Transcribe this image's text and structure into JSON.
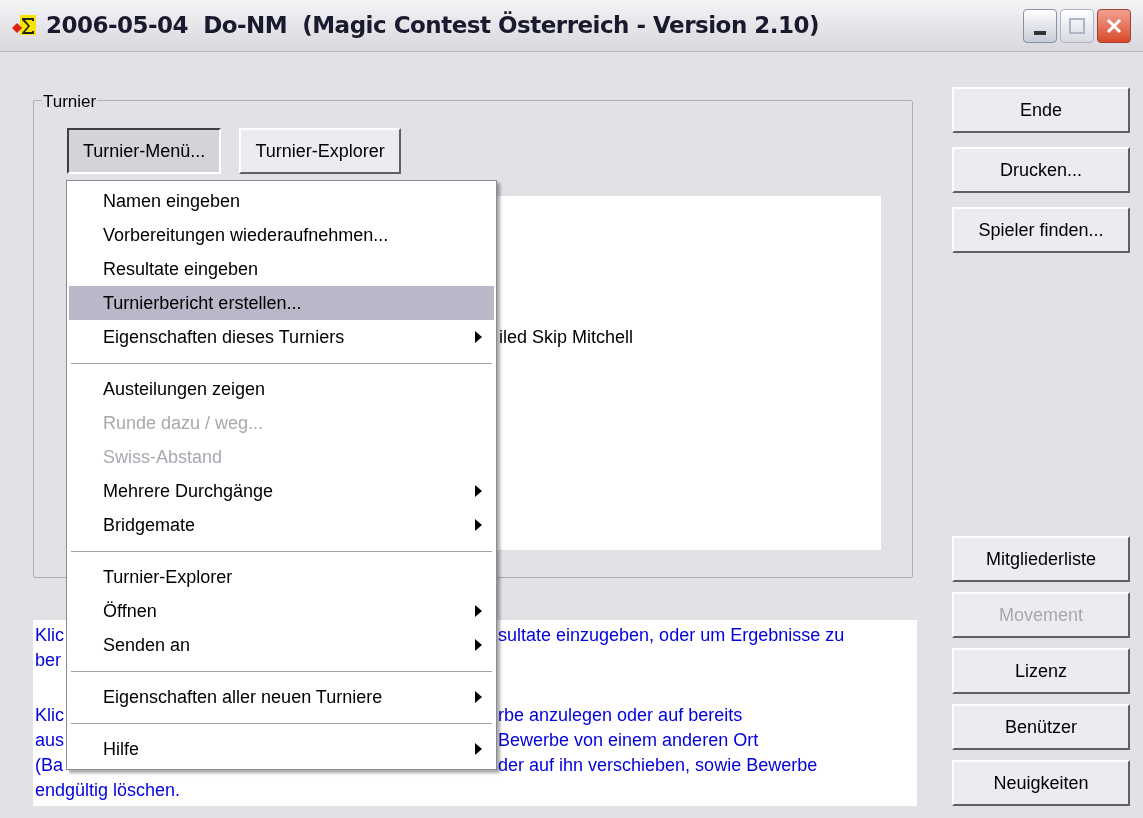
{
  "window": {
    "title": "2006-05-04  Do-NM  (Magic Contest Österreich - Version 2.10)"
  },
  "group": {
    "label": "Turnier",
    "buttons": [
      {
        "label": "Turnier-Menü...",
        "pressed": true
      },
      {
        "label": "Turnier-Explorer",
        "pressed": false
      }
    ],
    "panel_text": "iled Skip Mitchell"
  },
  "menu": [
    {
      "kind": "item",
      "label": "Namen eingeben",
      "submenu": false,
      "disabled": false,
      "selected": false
    },
    {
      "kind": "item",
      "label": "Vorbereitungen wiederaufnehmen...",
      "submenu": false,
      "disabled": false,
      "selected": false
    },
    {
      "kind": "item",
      "label": "Resultate eingeben",
      "submenu": false,
      "disabled": false,
      "selected": false
    },
    {
      "kind": "item",
      "label": "Turnierbericht erstellen...",
      "submenu": false,
      "disabled": false,
      "selected": true
    },
    {
      "kind": "item",
      "label": "Eigenschaften dieses Turniers",
      "submenu": true,
      "disabled": false,
      "selected": false
    },
    {
      "kind": "separator"
    },
    {
      "kind": "item",
      "label": "Austeilungen zeigen",
      "submenu": false,
      "disabled": false,
      "selected": false
    },
    {
      "kind": "item",
      "label": "Runde dazu / weg...",
      "submenu": false,
      "disabled": true,
      "selected": false
    },
    {
      "kind": "item",
      "label": "Swiss-Abstand",
      "submenu": false,
      "disabled": true,
      "selected": false
    },
    {
      "kind": "item",
      "label": "Mehrere Durchgänge",
      "submenu": true,
      "disabled": false,
      "selected": false
    },
    {
      "kind": "item",
      "label": "Bridgemate",
      "submenu": true,
      "disabled": false,
      "selected": false
    },
    {
      "kind": "separator"
    },
    {
      "kind": "item",
      "label": "Turnier-Explorer",
      "submenu": false,
      "disabled": false,
      "selected": false
    },
    {
      "kind": "item",
      "label": "Öffnen",
      "submenu": true,
      "disabled": false,
      "selected": false
    },
    {
      "kind": "item",
      "label": "Senden an",
      "submenu": true,
      "disabled": false,
      "selected": false
    },
    {
      "kind": "separator"
    },
    {
      "kind": "item",
      "label": "Eigenschaften aller neuen Turniere",
      "submenu": true,
      "disabled": false,
      "selected": false
    },
    {
      "kind": "separator"
    },
    {
      "kind": "item",
      "label": "Hilfe",
      "submenu": true,
      "disabled": false,
      "selected": false
    }
  ],
  "info_paragraphs": [
    [
      {
        "left": "Klic",
        "right": "sultate einzugeben, oder um Ergebnisse zu"
      },
      {
        "left": "ber"
      }
    ],
    [
      {
        "left": "Klic",
        "right": "rbe anzulegen oder auf bereits"
      },
      {
        "left": "aus",
        "right": "Bewerbe von einem anderen Ort"
      },
      {
        "left": "(Ba",
        "right": "der auf ihn verschieben, sowie Bewerbe"
      },
      {
        "left": "endgültig löschen."
      }
    ]
  ],
  "side_buttons_top": [
    {
      "label": "Ende",
      "disabled": false
    },
    {
      "label": "Drucken...",
      "disabled": false
    },
    {
      "label": "Spieler finden...",
      "disabled": false
    }
  ],
  "side_buttons_bottom": [
    {
      "label": "Mitgliederliste",
      "disabled": false
    },
    {
      "label": "Movement",
      "disabled": true
    },
    {
      "label": "Lizenz",
      "disabled": false
    },
    {
      "label": "Benützer",
      "disabled": false
    },
    {
      "label": "Neuigkeiten",
      "disabled": false
    }
  ]
}
